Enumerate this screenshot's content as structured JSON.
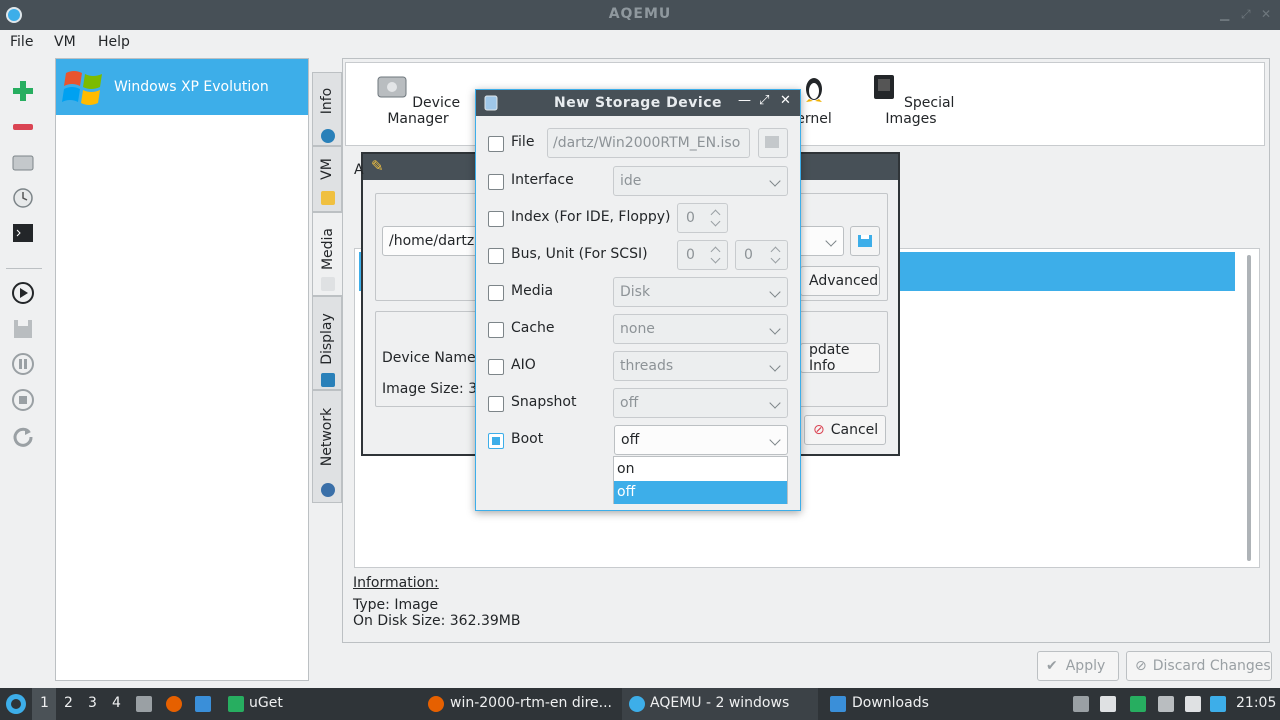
{
  "window": {
    "title": "AQEMU"
  },
  "menu": [
    "File",
    "VM",
    "Help"
  ],
  "vm_list": [
    {
      "name": "Windows XP Evolution"
    }
  ],
  "side_tabs": [
    "Info",
    "VM",
    "Media",
    "Display",
    "Network"
  ],
  "top_icons": [
    "Device Manager",
    "Kernel",
    "Special Images"
  ],
  "top_icon_partial": "ernel",
  "media_group": {
    "path_value": "/home/dartz",
    "advanced_label": "Advanced",
    "device_name_label": "Device Name:",
    "image_size_label": "Image Size: 36",
    "update_info_label": "pdate Info",
    "cancel_label": "Cancel",
    "title_fragment": "A"
  },
  "information": {
    "heading": "Information:",
    "type": "Type: Image",
    "disk_size": "On Disk Size: 362.39MB"
  },
  "buttons": {
    "apply": "Apply",
    "discard": "Discard Changes"
  },
  "dialog": {
    "title": "New Storage Device",
    "rows": [
      {
        "label": "File",
        "checked": false,
        "value": "/dartz/Win2000RTM_EN.iso"
      },
      {
        "label": "Interface",
        "checked": false,
        "value": "ide"
      },
      {
        "label": "Index (For IDE, Floppy)",
        "checked": false,
        "value": "0"
      },
      {
        "label": "Bus, Unit (For SCSI)",
        "checked": false,
        "value": "0",
        "value2": "0"
      },
      {
        "label": "Media",
        "checked": false,
        "value": "Disk"
      },
      {
        "label": "Cache",
        "checked": false,
        "value": "none"
      },
      {
        "label": "AIO",
        "checked": false,
        "value": "threads"
      },
      {
        "label": "Snapshot",
        "checked": false,
        "value": "off"
      },
      {
        "label": "Boot",
        "checked": true,
        "value": "off"
      }
    ],
    "boot_options": [
      "on",
      "off"
    ],
    "boot_selected": "off"
  },
  "taskbar": {
    "workspaces": [
      "1",
      "2",
      "3",
      "4"
    ],
    "tasks": [
      "uGet",
      "win-2000-rtm-en dire...",
      "AQEMU - 2 windows",
      "Downloads"
    ],
    "clock": "21:05"
  },
  "colors": {
    "accent": "#3daee9",
    "titlebar": "#475057",
    "taskbar": "#2f3438"
  }
}
